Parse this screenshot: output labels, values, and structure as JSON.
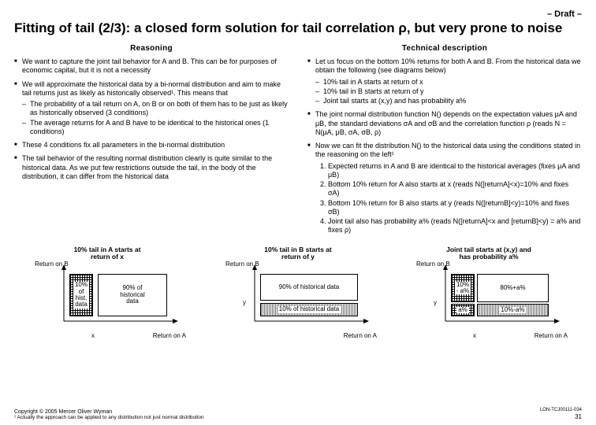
{
  "draft": "– Draft –",
  "title": "Fitting of tail (2/3): a closed form solution for tail correlation ρ, but very prone to noise",
  "left": {
    "head": "Reasoning",
    "b1": "We want to capture the joint tail behavior for A and B. This can be for purposes of economic capital, but it is not a necessity",
    "b2": "We will approximate the historical data by a bi-normal distribution and aim to make tail returns just as likely as historically observed¹. This means that",
    "b2a": "The probability of a tail return on A, on B or on both of them has to be just as likely as historically observed (3 conditions)",
    "b2b": "The average returns for A and B have to be identical to the historical ones (1 conditions)",
    "b3": "These 4 conditions fix all parameters in the bi-normal distribution",
    "b4": "The tail behavior of the resulting normal distribution clearly is quite similar to the historical data. As we put few restrictions outside the tail, in the body of the distribution, it can differ from the historical data"
  },
  "right": {
    "head": "Technical description",
    "b1": "Let us focus on the bottom 10% returns for both A and B. From the historical data we obtain the following (see diagrams below)",
    "b1a": "10% tail in A starts at return of x",
    "b1b": "10% tail in B starts at return of y",
    "b1c": "Joint tail starts at (x,y) and has probability a%",
    "b2": "The joint normal distribution function N() depends on the expectation values μA and μB, the standard deviations σA and σB and the correlation function ρ (reads N = N(μA, μB, σA, σB, ρ)",
    "b3": "Now we can fit the distribution N() to the historical data using the conditions stated in the reasoning on the left¹",
    "n1": "Expected returns in A and B are identical to the historical averages (fixes μA and μB)",
    "n2": "Bottom 10% return for A also starts at x (reads N([returnA]<x)=10% and fixes σA)",
    "n3": "Bottom 10% return for B also starts at y (reads N([returnB]<y)=10% and fixes σB)",
    "n4": "Joint tail also has probability a% (reads N([returnA]<x and [returnB]<y) = a% and fixes ρ)"
  },
  "d1": {
    "title": "10% tail in A starts at\nreturn of x",
    "ylabel": "Return\non B",
    "xlabel": "Return on A",
    "xtick": "x",
    "left": "10%\nof\nhist.\ndata",
    "right": "90% of\nhistorical\ndata"
  },
  "d2": {
    "title": "10% tail in B starts at\nreturn of y",
    "ylabel": "Return\non B",
    "xlabel": "Return on A",
    "ytick": "y",
    "top": "90% of historical data",
    "bot": "10% of historical data"
  },
  "d3": {
    "title": "Joint tail starts at (x,y) and\nhas probability a%",
    "ylabel": "Return\non B",
    "xlabel": "Return on A",
    "xtick": "x",
    "ytick": "y",
    "tl": "10%\n- a%",
    "tr": "80%+a%",
    "bl": "a%",
    "br": "10%-a%"
  },
  "copyright": "Copyright © 2005 Mercer Oliver Wyman",
  "footnote": "¹ Actually the approach can be applied to any distribution not just normal distribution",
  "docid": "LON-TCJ00111-034",
  "page": "31"
}
